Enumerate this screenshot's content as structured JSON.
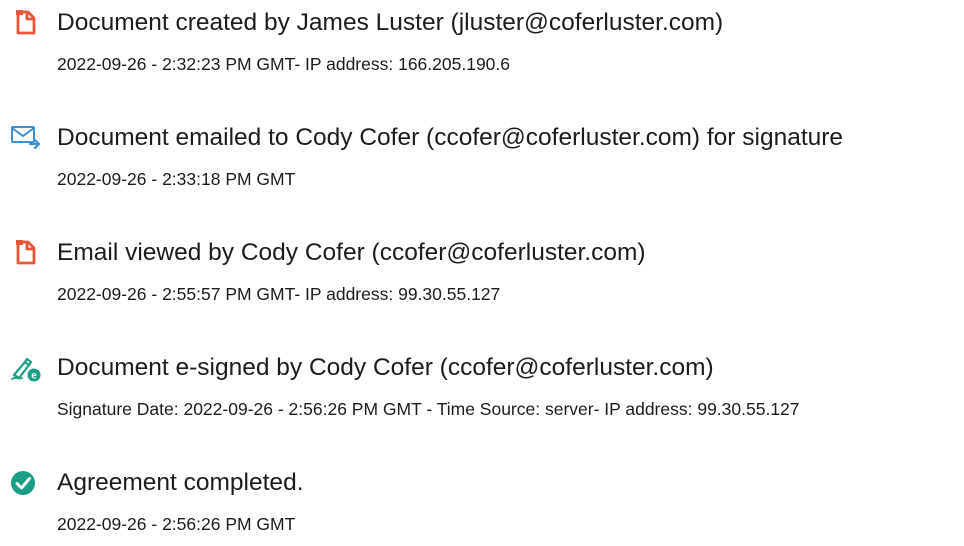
{
  "events": [
    {
      "icon": "document-created-icon",
      "title": "Document created by James Luster (jluster@coferluster.com)",
      "detail": "2022-09-26 - 2:32:23 PM GMT- IP address: 166.205.190.6"
    },
    {
      "icon": "email-sent-icon",
      "title": "Document emailed to Cody Cofer (ccofer@coferluster.com) for signature",
      "detail": "2022-09-26 - 2:33:18 PM GMT"
    },
    {
      "icon": "document-viewed-icon",
      "title": "Email viewed by Cody Cofer (ccofer@coferluster.com)",
      "detail": "2022-09-26 - 2:55:57 PM GMT- IP address: 99.30.55.127"
    },
    {
      "icon": "e-sign-icon",
      "title": "Document e-signed by Cody Cofer (ccofer@coferluster.com)",
      "detail": "Signature Date: 2022-09-26 - 2:56:26 PM GMT - Time Source: server- IP address: 99.30.55.127"
    },
    {
      "icon": "check-circle-icon",
      "title": "Agreement completed.",
      "detail": "2022-09-26 - 2:56:26 PM GMT"
    }
  ],
  "colors": {
    "orange": "#e8573a",
    "blue": "#3d8fd6",
    "green": "#1a9e85",
    "text": "#1c1c1c"
  }
}
